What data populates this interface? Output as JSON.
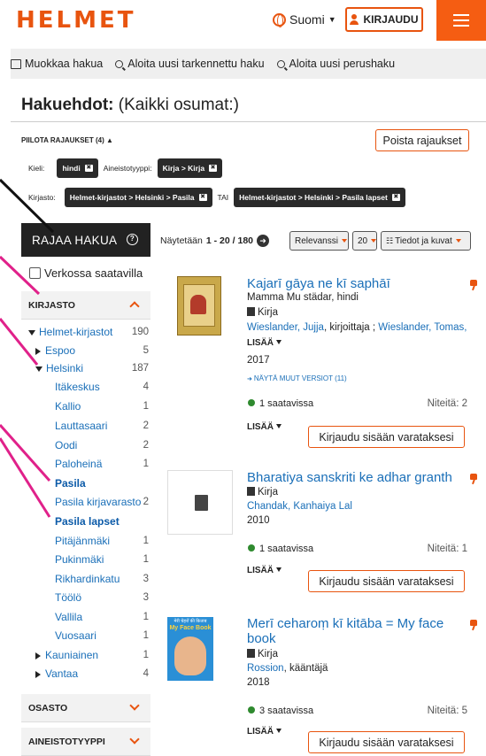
{
  "header": {
    "logo": "HELMET",
    "language": "Suomi",
    "login": "KIRJAUDU"
  },
  "actions": {
    "edit": "Muokkaa hakua",
    "advanced": "Aloita uusi tarkennettu haku",
    "basic": "Aloita uusi perushaku"
  },
  "criteria": {
    "title_bold": "Hakuehdot:",
    "title_rest": "(Kaikki osumat:)",
    "hide": "PIILOTA RAJAUKSET (4)",
    "clear": "Poista rajaukset",
    "lang_label": "Kieli:",
    "lang_chip": "hindi",
    "type_label": "Aineistotyyppi:",
    "type_chip": "Kirja > Kirja",
    "lib_label": "Kirjasto:",
    "lib_chip1": "Helmet-kirjastot > Helsinki > Pasila",
    "or": "TAI",
    "lib_chip2": "Helmet-kirjastot > Helsinki > Pasila lapset",
    "x": "✖"
  },
  "sidebar": {
    "narrow": "RAJAA HAKUA",
    "help": "?",
    "online": "Verkossa saatavilla",
    "library_head": "KIRJASTO",
    "tree": [
      {
        "label": "Helmet-kirjastot",
        "count": "190"
      },
      {
        "label": "Espoo",
        "count": "5"
      },
      {
        "label": "Helsinki",
        "count": "187"
      },
      {
        "label": "Itäkeskus",
        "count": "4"
      },
      {
        "label": "Kallio",
        "count": "1"
      },
      {
        "label": "Lauttasaari",
        "count": "2"
      },
      {
        "label": "Oodi",
        "count": "2"
      },
      {
        "label": "Paloheinä",
        "count": "1"
      },
      {
        "label": "Pasila",
        "count": ""
      },
      {
        "label": "Pasila kirjavarasto",
        "count": "2"
      },
      {
        "label": "Pasila lapset",
        "count": ""
      },
      {
        "label": "Pitäjänmäki",
        "count": "1"
      },
      {
        "label": "Pukinmäki",
        "count": "1"
      },
      {
        "label": "Rikhardinkatu",
        "count": "3"
      },
      {
        "label": "Töölö",
        "count": "3"
      },
      {
        "label": "Vallila",
        "count": "1"
      },
      {
        "label": "Vuosaari",
        "count": "1"
      },
      {
        "label": "Kauniainen",
        "count": "1"
      },
      {
        "label": "Vantaa",
        "count": "4"
      }
    ],
    "dept_head": "OSASTO",
    "type_head": "AINEISTOTYYPPI"
  },
  "results": {
    "showing_prefix": "Näytetään",
    "showing_range": "1 - 20 / 180",
    "sort": "Relevanssi",
    "per_page": "20",
    "view": "Tiedot ja kuvat"
  },
  "records": [
    {
      "title": "Kajarī gāya ne kī saphāī",
      "subtitle": "Mamma Mu städar, hindi",
      "format": "Kirja",
      "author1": "Wieslander, Jujja",
      "role1": ", kirjoittaja ; ",
      "author2": "Wieslander, Tomas,",
      "more": "LISÄÄ",
      "year": "2017",
      "versions": "NÄYTÄ MUUT VERSIOT (11)",
      "available": "1 saatavissa",
      "copies": "Niteitä: 2",
      "more2": "LISÄÄ",
      "reserve": "Kirjaudu sisään varataksesi"
    },
    {
      "title": "Bharatiya sanskriti ke adhar granth",
      "format": "Kirja",
      "author1": "Chandak, Kanhaiya Lal",
      "year": "2010",
      "available": "1 saatavissa",
      "copies": "Niteitä: 1",
      "more2": "LISÄÄ",
      "reserve": "Kirjaudu sisään varataksesi"
    },
    {
      "title": "Merī ceharoṃ kī kitāba = My face book",
      "format": "Kirja",
      "author1": "Rossion",
      "role1": ", kääntäjä",
      "year": "2018",
      "cover_text_top": "मेरी चेहरों की किताब",
      "cover_text": "My Face Book",
      "available": "3 saatavissa",
      "copies": "Niteitä: 5",
      "more2": "LISÄÄ",
      "reserve": "Kirjaudu sisään varataksesi"
    }
  ],
  "colors": {
    "brand": "#e8540f",
    "link": "#1a6fb8",
    "annotation_pink": "#e0218a"
  }
}
